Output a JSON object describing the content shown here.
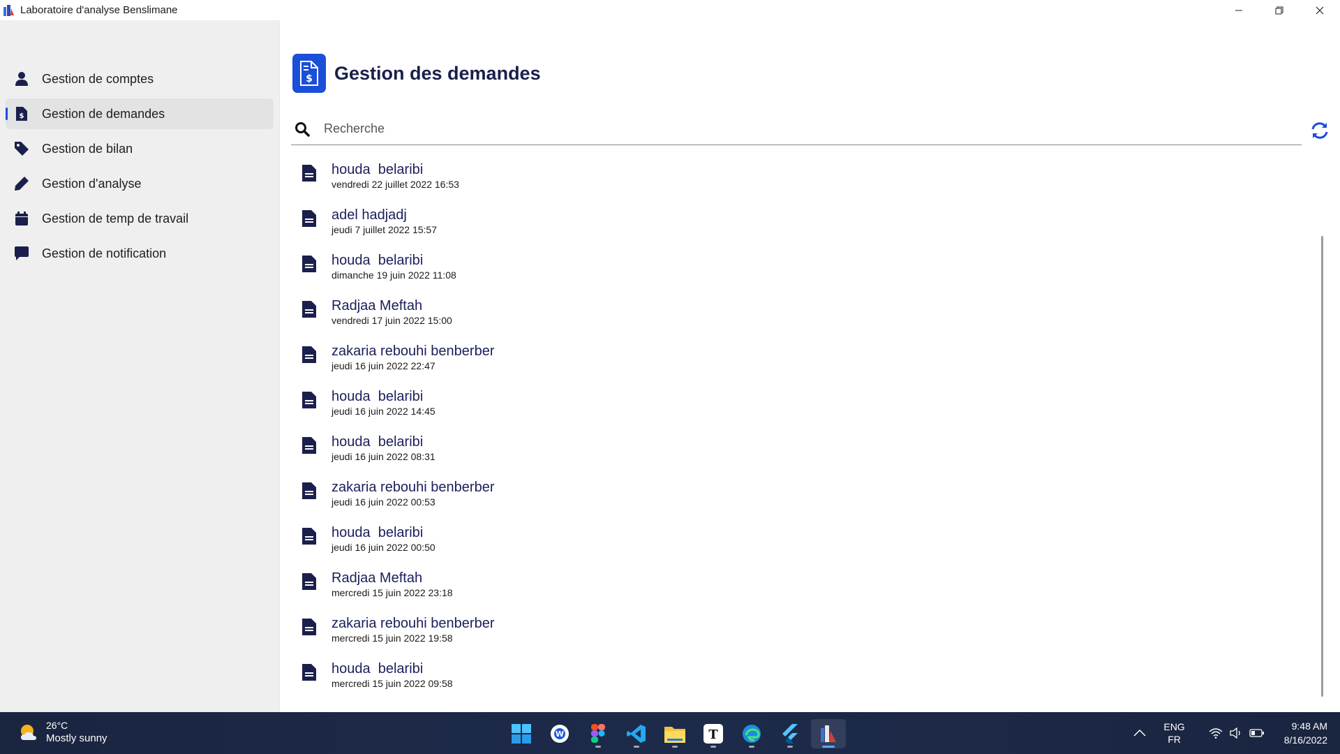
{
  "window": {
    "title": "Laboratoire d'analyse Benslimane"
  },
  "sidebar": {
    "items": [
      {
        "label": "Gestion de comptes",
        "icon": "user-icon"
      },
      {
        "label": "Gestion de demandes",
        "icon": "invoice-icon",
        "active": true
      },
      {
        "label": "Gestion de bilan",
        "icon": "tag-icon"
      },
      {
        "label": "Gestion d'analyse",
        "icon": "pen-icon"
      },
      {
        "label": "Gestion de temp de travail",
        "icon": "calendar-icon"
      },
      {
        "label": "Gestion de notification",
        "icon": "comment-icon"
      }
    ]
  },
  "main": {
    "title": "Gestion des demandes",
    "search": {
      "placeholder": "Recherche",
      "value": ""
    },
    "requests": [
      {
        "name": "houda  belaribi",
        "date": "vendredi 22 juillet 2022 16:53"
      },
      {
        "name": "adel hadjadj",
        "date": "jeudi 7 juillet 2022 15:57"
      },
      {
        "name": "houda  belaribi",
        "date": "dimanche 19 juin 2022 11:08"
      },
      {
        "name": "Radjaa Meftah",
        "date": "vendredi 17 juin 2022 15:00"
      },
      {
        "name": "zakaria rebouhi benberber",
        "date": "jeudi 16 juin 2022 22:47"
      },
      {
        "name": "houda  belaribi",
        "date": "jeudi 16 juin 2022 14:45"
      },
      {
        "name": "houda  belaribi",
        "date": "jeudi 16 juin 2022 08:31"
      },
      {
        "name": "zakaria rebouhi benberber",
        "date": "jeudi 16 juin 2022 00:53"
      },
      {
        "name": "houda  belaribi",
        "date": "jeudi 16 juin 2022 00:50"
      },
      {
        "name": "Radjaa Meftah",
        "date": "mercredi 15 juin 2022 23:18"
      },
      {
        "name": "zakaria rebouhi benberber",
        "date": "mercredi 15 juin 2022 19:58"
      },
      {
        "name": "houda  belaribi",
        "date": "mercredi 15 juin 2022 09:58"
      }
    ]
  },
  "taskbar": {
    "weather": {
      "temp": "26°C",
      "desc": "Mostly sunny"
    },
    "apps": [
      "windows-start-icon",
      "search-app-icon",
      "figma-icon",
      "vscode-icon",
      "file-explorer-icon",
      "typora-icon",
      "edge-icon",
      "flutter-icon",
      "lab-app-icon"
    ],
    "lang": {
      "line1": "ENG",
      "line2": "FR"
    },
    "clock": {
      "time": "9:48 AM",
      "date": "8/16/2022"
    }
  },
  "colors": {
    "accent": "#1a4fd8",
    "sidebar_bg": "#efefef",
    "heading": "#1b1f4b",
    "taskbar_bg": "#1d2a4a"
  }
}
